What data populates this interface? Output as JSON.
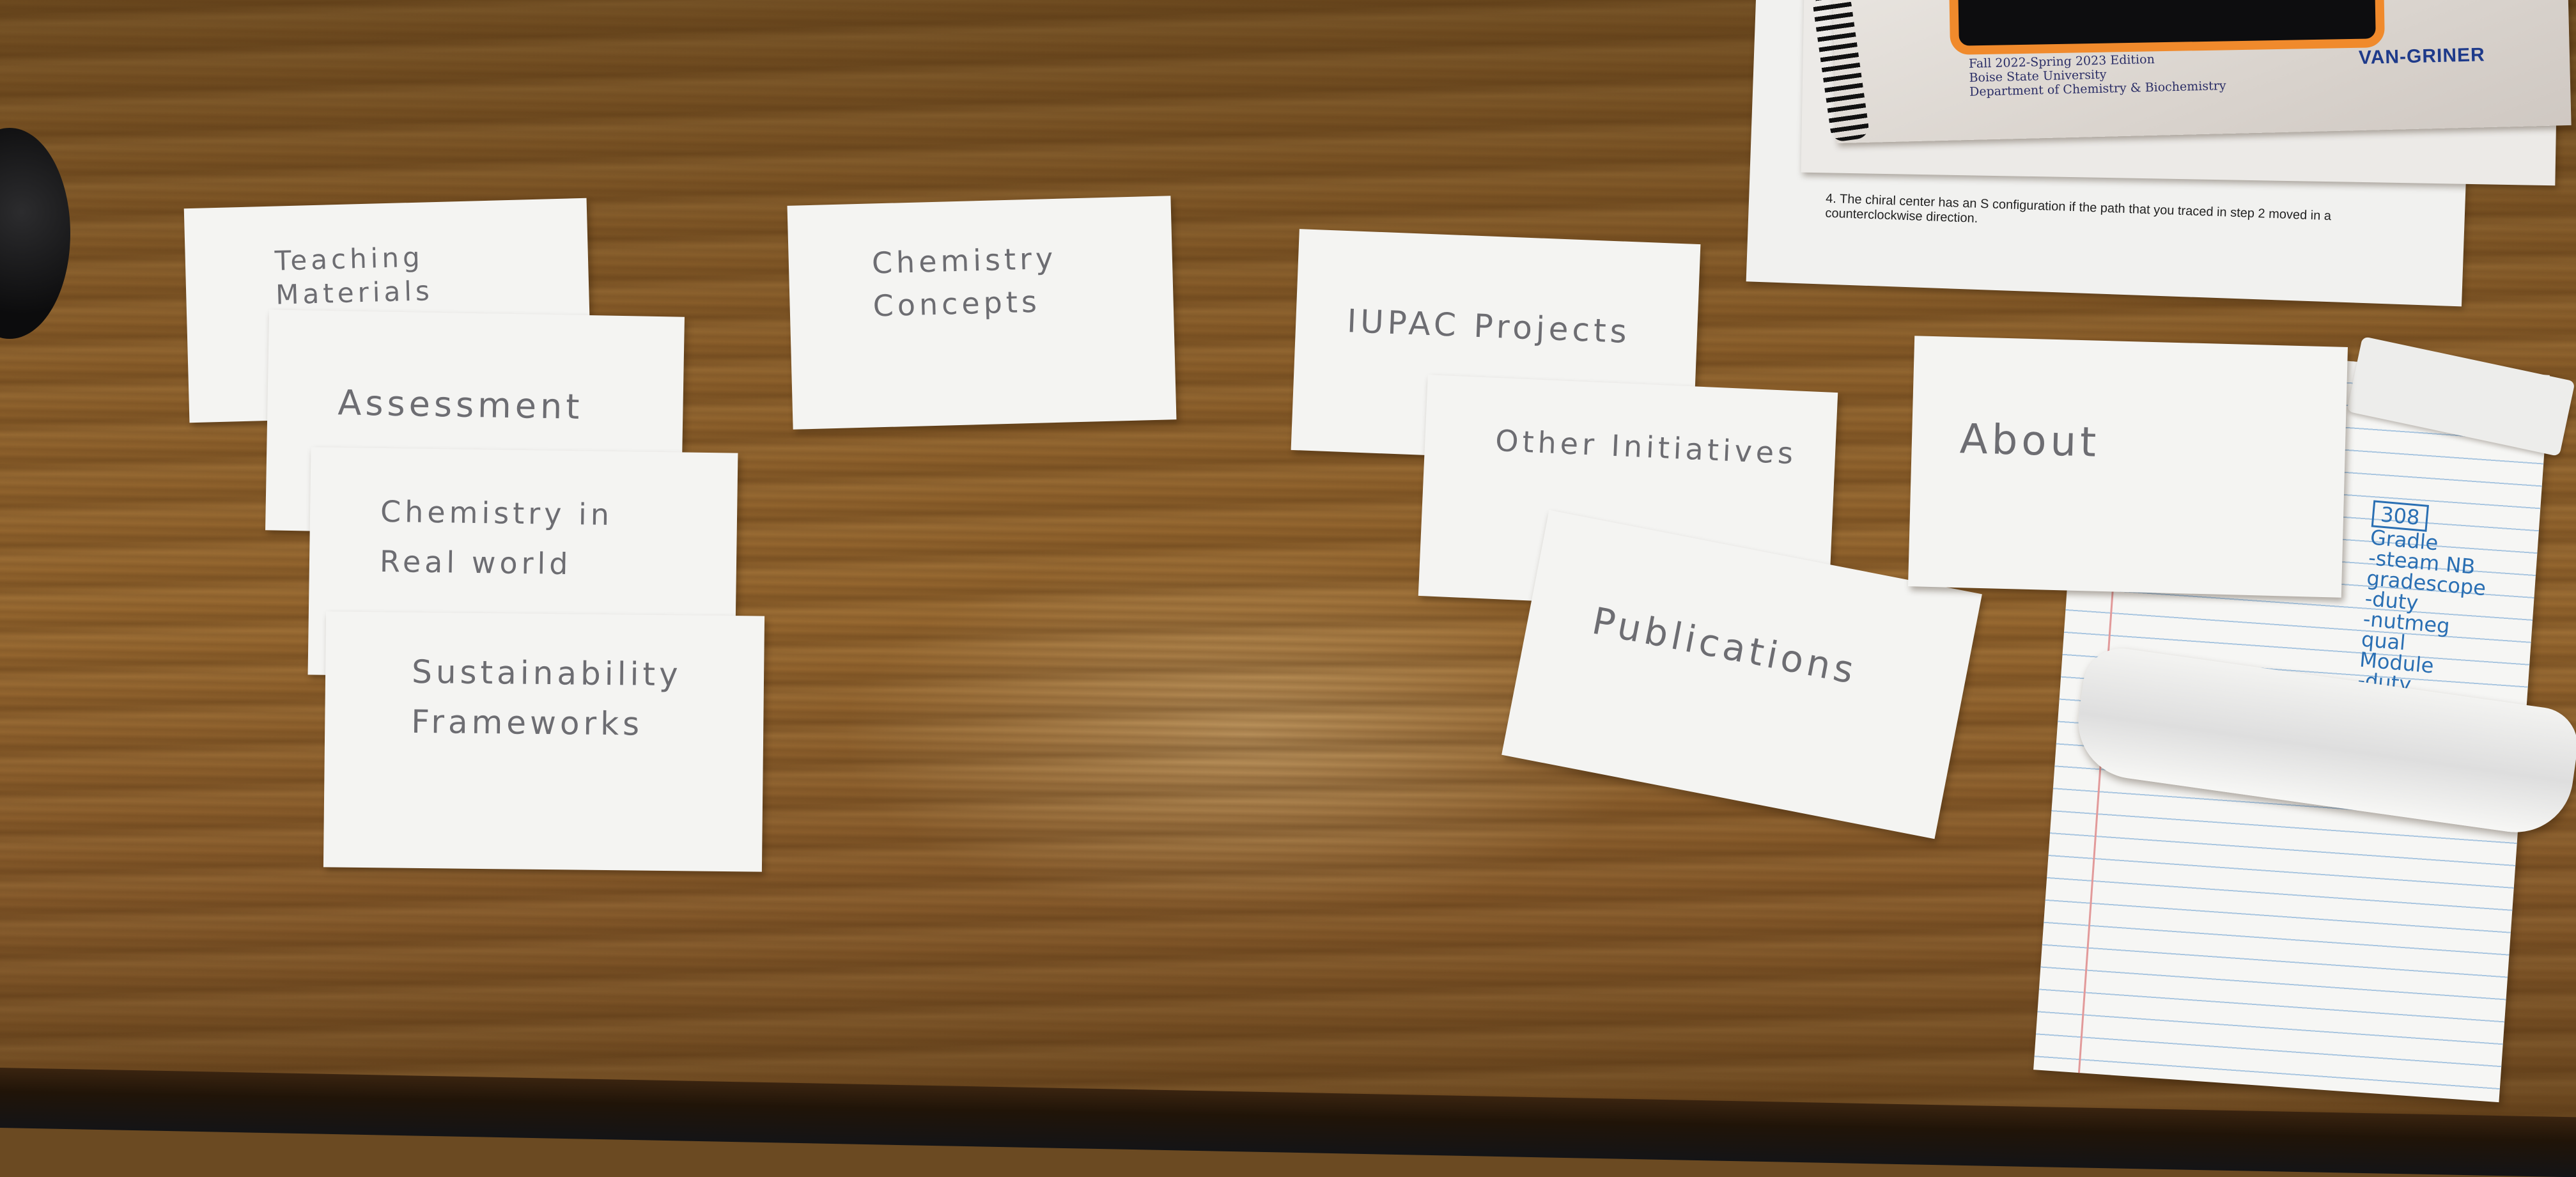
{
  "cards": {
    "teaching_materials": "Teaching Materials",
    "assessment": "Assessment",
    "chemistry_real_world": "Chemistry in\nReal world",
    "sustainability": "Sustainability\nFrameworks",
    "chemistry_concepts": "Chemistry\nConcepts",
    "iupac_projects": "IUPAC Projects",
    "other_initiatives": "Other Initiatives",
    "publications": "Publications",
    "about": "About"
  },
  "booklet": {
    "edition": "Fall 2022-Spring 2023 Edition",
    "university": "Boise State University",
    "department": "Department of Chemistry & Biochemistry",
    "publisher": "VAN-GRINER"
  },
  "worksheet": {
    "step4": "4. The chiral center has an S configuration if the path that you traced in step 2 moved in a counterclockwise direction."
  },
  "handwritten_notes": {
    "room": "308",
    "lines": [
      "Gradle",
      "-steam NB",
      "gradescope",
      "-duty",
      "-nutmeg",
      "qual",
      "Module",
      "-duty"
    ]
  },
  "colors": {
    "desk": "#8a5e2a",
    "card": "#f4f4f2",
    "ink_pencil": "#6d6d72",
    "ink_blue": "#2a6fb3",
    "phone_case": "#f08a2c"
  }
}
